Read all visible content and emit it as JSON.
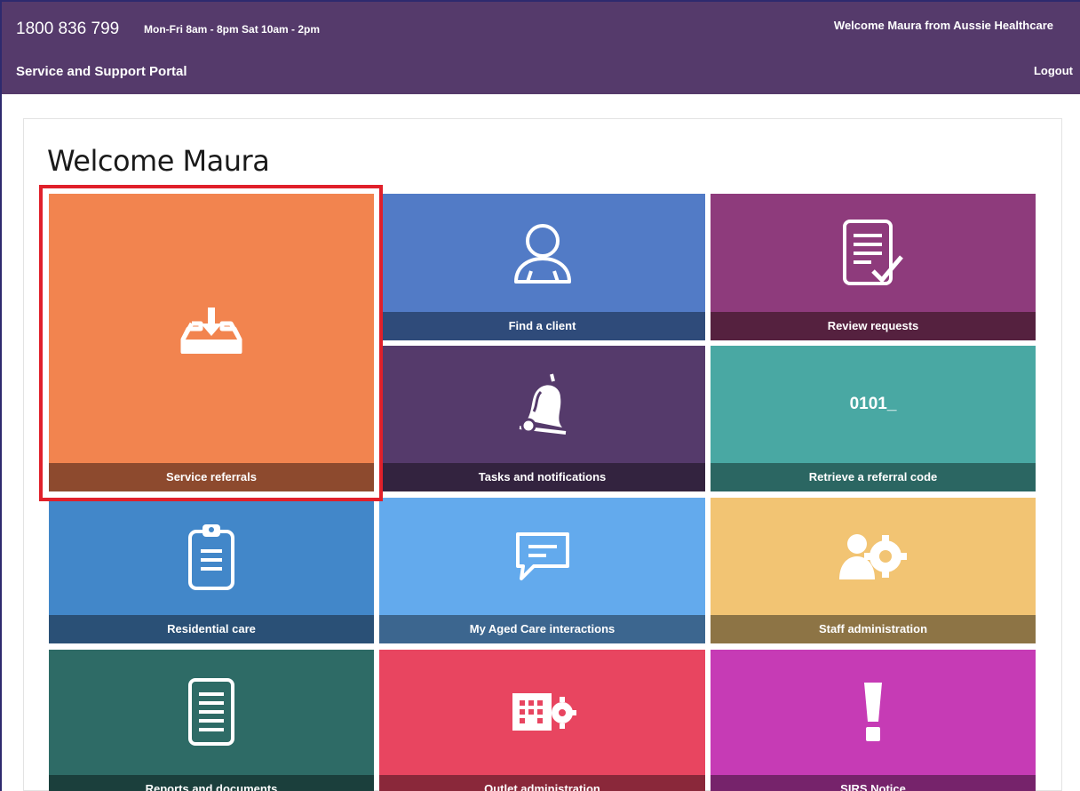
{
  "header": {
    "phone": "1800 836 799",
    "hours": "Mon-Fri 8am - 8pm Sat 10am - 2pm",
    "welcome": "Welcome Maura from Aussie Healthcare",
    "portal_title": "Service and Support Portal",
    "logout": "Logout"
  },
  "main": {
    "heading": "Welcome Maura"
  },
  "tiles": [
    {
      "label": "Service referrals",
      "icon": "inbox-download-icon",
      "color": "#f2844f",
      "label_bg": "#8d4a2e"
    },
    {
      "label": "Find a client",
      "icon": "person-icon",
      "color": "#527bc6",
      "label_bg": "#2f4b7a"
    },
    {
      "label": "Review requests",
      "icon": "document-check-icon",
      "color": "#8e3b7c",
      "label_bg": "#55213f"
    },
    {
      "label": "Tasks and notifications",
      "icon": "bell-icon",
      "color": "#553a6b",
      "label_bg": "#33233f"
    },
    {
      "label": "Retrieve a referral code",
      "icon_text": "0101_",
      "icon": "code-icon",
      "color": "#49a8a3",
      "label_bg": "#2b6662"
    },
    {
      "label": "Residential care",
      "icon": "clipboard-icon",
      "color": "#4287c9",
      "label_bg": "#2a5076"
    },
    {
      "label": "My Aged Care interactions",
      "icon": "chat-icon",
      "color": "#63aaed",
      "label_bg": "#3c668f"
    },
    {
      "label": "Staff administration",
      "icon": "people-gear-icon",
      "color": "#f2c473",
      "label_bg": "#8d7445"
    },
    {
      "label": "Reports and documents",
      "icon": "report-icon",
      "color": "#2e6b66",
      "label_bg": "#1b3f3c"
    },
    {
      "label": "Outlet administration",
      "icon": "building-gear-icon",
      "color": "#e84560",
      "label_bg": "#8a283a"
    },
    {
      "label": "SIRS Notice",
      "icon": "exclamation-icon",
      "color": "#c63bb5",
      "label_bg": "#76236b"
    }
  ]
}
